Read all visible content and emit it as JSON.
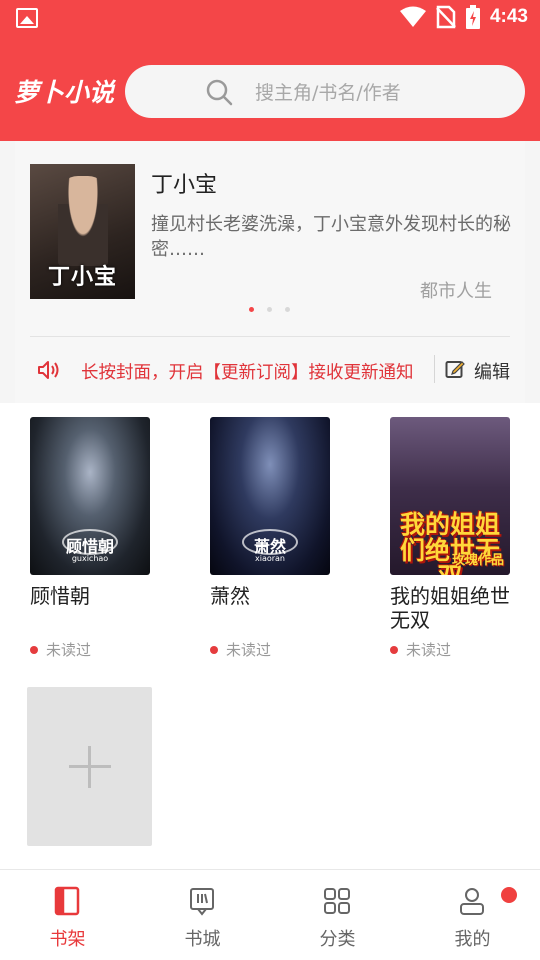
{
  "status_bar": {
    "time": "4:43",
    "icons": [
      "gallery-icon",
      "wifi-icon",
      "no-sim-icon",
      "battery-charging-icon"
    ]
  },
  "header": {
    "app_name": "萝卜小说",
    "search_placeholder": "搜主角/书名/作者",
    "accent_color": "#f44648"
  },
  "featured": {
    "cover_text": "丁小宝",
    "title": "丁小宝",
    "description": "撞见村长老婆洗澡，丁小宝意外发现村长的秘密……",
    "genre": "都市人生",
    "page_count": 3,
    "active_page": 1
  },
  "notice": {
    "text": "长按封面，开启【更新订阅】接收更新通知",
    "edit_label": "编辑"
  },
  "books": [
    {
      "title": "顾惜朝",
      "cover_text": "顾惜朝",
      "cover_subtext": "guxichao",
      "status": "未读过"
    },
    {
      "title": "萧然",
      "cover_text": "萧然",
      "cover_subtext": "xiaoran",
      "status": "未读过"
    },
    {
      "title": "我的姐姐绝世无双",
      "cover_text": "我的姐姐们绝世无双",
      "cover_author": "玫瑰作品",
      "status": "未读过"
    }
  ],
  "add_book": {
    "icon": "plus-icon"
  },
  "nav": [
    {
      "label": "书架",
      "icon": "bookshelf-icon",
      "active": true
    },
    {
      "label": "书城",
      "icon": "bookstore-icon",
      "active": false
    },
    {
      "label": "分类",
      "icon": "category-icon",
      "active": false
    },
    {
      "label": "我的",
      "icon": "profile-icon",
      "active": false
    }
  ]
}
